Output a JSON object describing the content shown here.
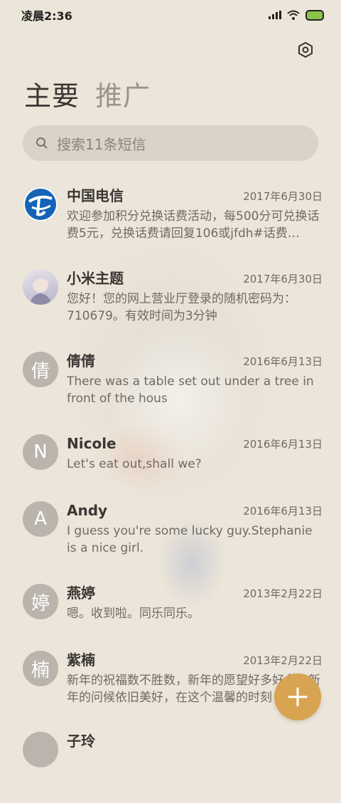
{
  "status": {
    "time": "凌晨2:36"
  },
  "tabs": {
    "main": "主要",
    "promo": "推广"
  },
  "search": {
    "placeholder": "搜索11条短信"
  },
  "messages": [
    {
      "name": "中国电信",
      "date": "2017年6月30日",
      "preview": "欢迎参加积分兑换话费活动，每500分可兑换话费5元，兑换话费请回复106或jfdh#话费…",
      "avatar": ""
    },
    {
      "name": "小米主题",
      "date": "2017年6月30日",
      "preview": "您好！您的网上营业厅登录的随机密码为：710679。有效时间为3分钟",
      "avatar": ""
    },
    {
      "name": "倩倩",
      "date": "2016年6月13日",
      "preview": "There was a table set out under a tree in front of the hous",
      "avatar": "倩"
    },
    {
      "name": "Nicole",
      "date": "2016年6月13日",
      "preview": "Let's eat out,shall we?",
      "avatar": "N"
    },
    {
      "name": "Andy",
      "date": "2016年6月13日",
      "preview": "I guess you're some lucky guy.Stephanie is a nice girl.",
      "avatar": "A"
    },
    {
      "name": "燕婷",
      "date": "2013年2月22日",
      "preview": "嗯。收到啦。同乐同乐。",
      "avatar": "婷"
    },
    {
      "name": "紫楠",
      "date": "2013年2月22日",
      "preview": "新年的祝福数不胜数，新年的愿望好多好多，新年的问候依旧美好，在这个温馨的时刻",
      "avatar": "楠"
    },
    {
      "name": "子玲",
      "date": "",
      "preview": "",
      "avatar": ""
    }
  ],
  "colors": {
    "accent": "#d8a451",
    "background": "#ece5d9"
  },
  "icons": {
    "settings": "settings-icon",
    "search": "search-icon",
    "add": "plus-icon"
  }
}
